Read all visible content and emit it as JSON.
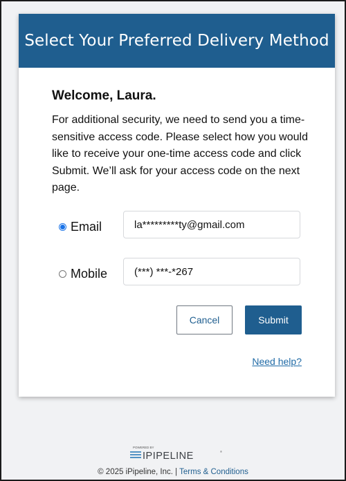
{
  "header": {
    "title": "Select Your Preferred Delivery Method"
  },
  "welcome": "Welcome, Laura.",
  "instructions": "For additional security, we need to send you a time-sensitive access code. Please select how you would like to receive your one-time access code and click Submit. We’ll ask for your access code on the next page.",
  "options": [
    {
      "label": "Email",
      "value": "la*********ty@gmail.com",
      "selected": true
    },
    {
      "label": "Mobile",
      "value": "(***) ***-*267",
      "selected": false
    }
  ],
  "buttons": {
    "cancel": "Cancel",
    "submit": "Submit"
  },
  "help_link": "Need help?",
  "footer": {
    "logo_powered_by": "POWERED BY",
    "logo_name": "IPIPELINE",
    "copyright": "© 2025 iPipeline, Inc. | ",
    "terms_link": "Terms & Conditions"
  },
  "colors": {
    "header_bg": "#1f5e8f",
    "submit_bg": "#1f5e8f",
    "radio_accent": "#1a73e8",
    "page_bg": "#f1f2f4"
  }
}
